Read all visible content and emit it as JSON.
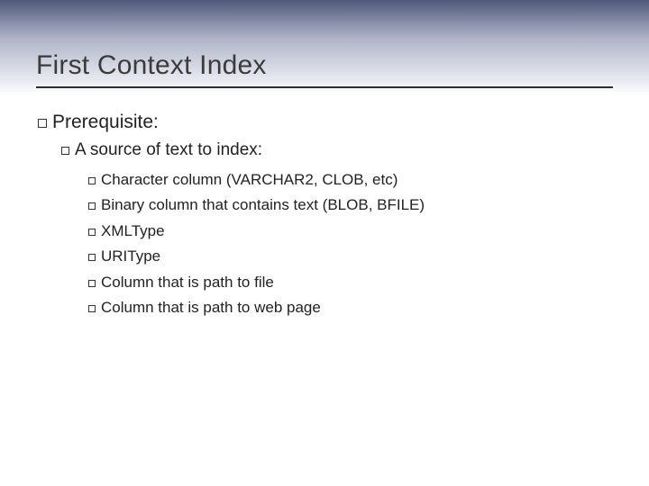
{
  "title": "First Context Index",
  "lvl1": {
    "text": "Prerequisite:"
  },
  "lvl2": {
    "text": "A source of text to index:"
  },
  "lvl3": [
    {
      "text": "Character column (VARCHAR2, CLOB, etc)"
    },
    {
      "text": "Binary column that contains text (BLOB, BFILE)"
    },
    {
      "text": "XMLType"
    },
    {
      "text": "URIType"
    },
    {
      "text": "Column that is path to file"
    },
    {
      "text": "Column that is path to web page"
    }
  ]
}
